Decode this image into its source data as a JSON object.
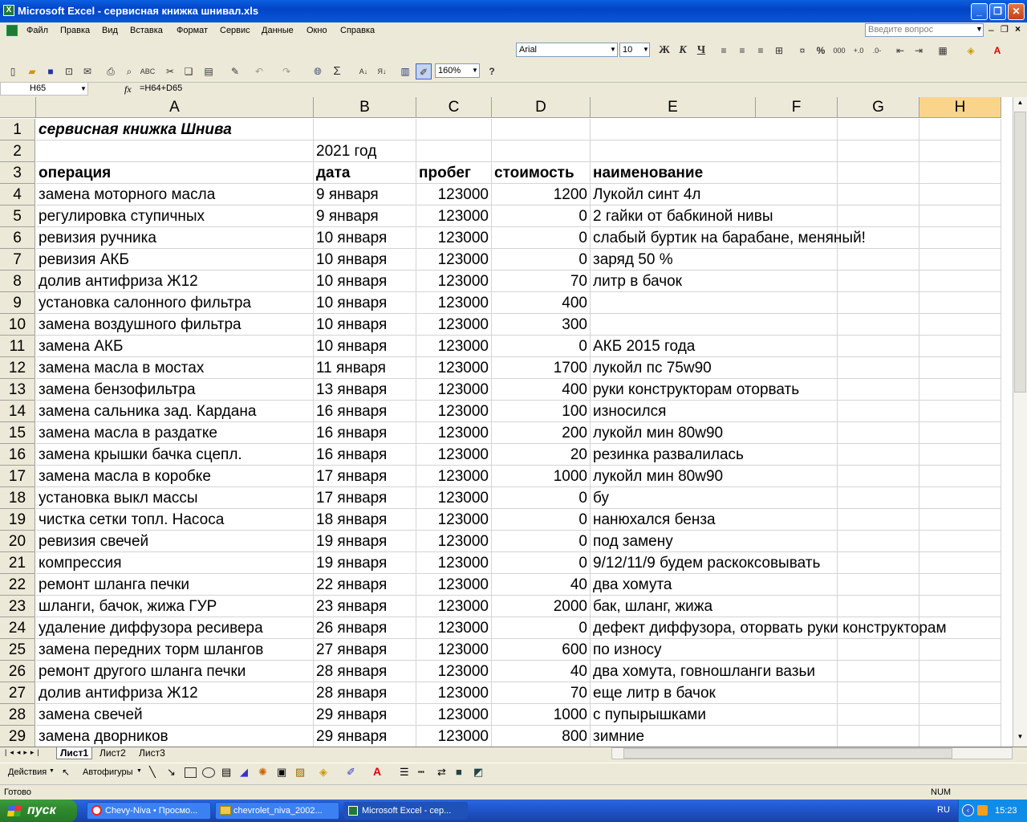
{
  "window": {
    "title": "Microsoft Excel - сервисная книжка шнивал.xls"
  },
  "menu": [
    "Файл",
    "Правка",
    "Вид",
    "Вставка",
    "Формат",
    "Сервис",
    "Данные",
    "Окно",
    "Справка"
  ],
  "ask_placeholder": "Введите вопрос",
  "format_toolbar": {
    "font": "Arial",
    "size": "10",
    "bold": "Ж",
    "italic": "К",
    "underline": "Ч"
  },
  "standard_toolbar": {
    "zoom": "160%"
  },
  "formula_bar": {
    "name_box": "H65",
    "fx": "fx",
    "formula": "=H64+D65"
  },
  "columns": [
    "A",
    "B",
    "C",
    "D",
    "E",
    "F",
    "G",
    "H"
  ],
  "selected_column": "H",
  "rows": [
    {
      "n": "1",
      "a": "сервисная книжка Шнива",
      "b": "",
      "c": "",
      "d": "",
      "e": ""
    },
    {
      "n": "2",
      "a": "",
      "b": "2021 год",
      "c": "",
      "d": "",
      "e": ""
    },
    {
      "n": "3",
      "a": "операция",
      "b": "дата",
      "c": "пробег",
      "d": "стоимость",
      "e": "наименование"
    },
    {
      "n": "4",
      "a": "замена моторного масла",
      "b": "9 января",
      "c": "123000",
      "d": "1200",
      "e": "Лукойл синт 4л"
    },
    {
      "n": "5",
      "a": "регулировка ступичных",
      "b": "9 января",
      "c": "123000",
      "d": "0",
      "e": "2 гайки от бабкиной нивы"
    },
    {
      "n": "6",
      "a": "ревизия ручника",
      "b": "10 января",
      "c": "123000",
      "d": "0",
      "e": "слабый буртик на барабане, меняный!"
    },
    {
      "n": "7",
      "a": "ревизия АКБ",
      "b": "10 января",
      "c": "123000",
      "d": "0",
      "e": "заряд 50 %"
    },
    {
      "n": "8",
      "a": "долив антифриза Ж12",
      "b": "10 января",
      "c": "123000",
      "d": "70",
      "e": "литр в бачок"
    },
    {
      "n": "9",
      "a": "установка салонного фильтра",
      "b": "10 января",
      "c": "123000",
      "d": "400",
      "e": ""
    },
    {
      "n": "10",
      "a": "замена воздушного фильтра",
      "b": "10 января",
      "c": "123000",
      "d": "300",
      "e": ""
    },
    {
      "n": "11",
      "a": "замена АКБ",
      "b": "10 января",
      "c": "123000",
      "d": "0",
      "e": "АКБ 2015 года"
    },
    {
      "n": "12",
      "a": "замена масла в мостах",
      "b": "11 января",
      "c": "123000",
      "d": "1700",
      "e": "лукойл пс 75w90"
    },
    {
      "n": "13",
      "a": "замена бензофильтра",
      "b": "13 января",
      "c": "123000",
      "d": "400",
      "e": "руки конструкторам оторвать"
    },
    {
      "n": "14",
      "a": "замена сальника зад. Кардана",
      "b": "16 января",
      "c": "123000",
      "d": "100",
      "e": "износился"
    },
    {
      "n": "15",
      "a": "замена масла в раздатке",
      "b": "16 января",
      "c": "123000",
      "d": "200",
      "e": "лукойл мин 80w90"
    },
    {
      "n": "16",
      "a": "замена крышки бачка сцепл.",
      "b": "16 января",
      "c": "123000",
      "d": "20",
      "e": "резинка развалилась"
    },
    {
      "n": "17",
      "a": "замена масла в коробке",
      "b": "17 января",
      "c": "123000",
      "d": "1000",
      "e": "лукойл мин 80w90"
    },
    {
      "n": "18",
      "a": "установка выкл массы",
      "b": "17 января",
      "c": "123000",
      "d": "0",
      "e": "бу"
    },
    {
      "n": "19",
      "a": "чистка сетки топл. Насоса",
      "b": "18 января",
      "c": "123000",
      "d": "0",
      "e": "нанюхался бенза"
    },
    {
      "n": "20",
      "a": "ревизия свечей",
      "b": "19 января",
      "c": "123000",
      "d": "0",
      "e": "под замену"
    },
    {
      "n": "21",
      "a": "компрессия",
      "b": "19 января",
      "c": "123000",
      "d": "0",
      "e": "9/12/11/9 будем раскоксовывать"
    },
    {
      "n": "22",
      "a": "ремонт шланга печки",
      "b": "22 января",
      "c": "123000",
      "d": "40",
      "e": "два хомута"
    },
    {
      "n": "23",
      "a": "шланги, бачок, жижа ГУР",
      "b": "23 января",
      "c": "123000",
      "d": "2000",
      "e": "бак, шланг, жижа"
    },
    {
      "n": "24",
      "a": "удаление диффузора ресивера",
      "b": "26 января",
      "c": "123000",
      "d": "0",
      "e": "дефект диффузора, оторвать руки конструкторам"
    },
    {
      "n": "25",
      "a": "замена передних торм шлангов",
      "b": "27 января",
      "c": "123000",
      "d": "600",
      "e": "по износу"
    },
    {
      "n": "26",
      "a": "ремонт другого шланга печки",
      "b": "28 января",
      "c": "123000",
      "d": "40",
      "e": "два хомута, говношланги вазьи"
    },
    {
      "n": "27",
      "a": "долив антифриза Ж12",
      "b": "28 января",
      "c": "123000",
      "d": "70",
      "e": "еще литр в бачок"
    },
    {
      "n": "28",
      "a": "замена свечей",
      "b": "29 января",
      "c": "123000",
      "d": "1000",
      "e": "с пупырышками"
    },
    {
      "n": "29",
      "a": "замена дворников",
      "b": "29 января",
      "c": "123000",
      "d": "800",
      "e": "зимние"
    }
  ],
  "sheets": [
    "Лист1",
    "Лист2",
    "Лист3"
  ],
  "draw_bar": {
    "actions": "Действия",
    "autoshapes": "Автофигуры"
  },
  "status": {
    "left": "Готово",
    "num": "NUM"
  },
  "taskbar": {
    "start": "пуск",
    "buttons": [
      "Chevy-Niva • Просмо...",
      "chevrolet_niva_2002...",
      "Microsoft Excel - сер..."
    ],
    "lang": "RU",
    "clock": "15:23"
  }
}
